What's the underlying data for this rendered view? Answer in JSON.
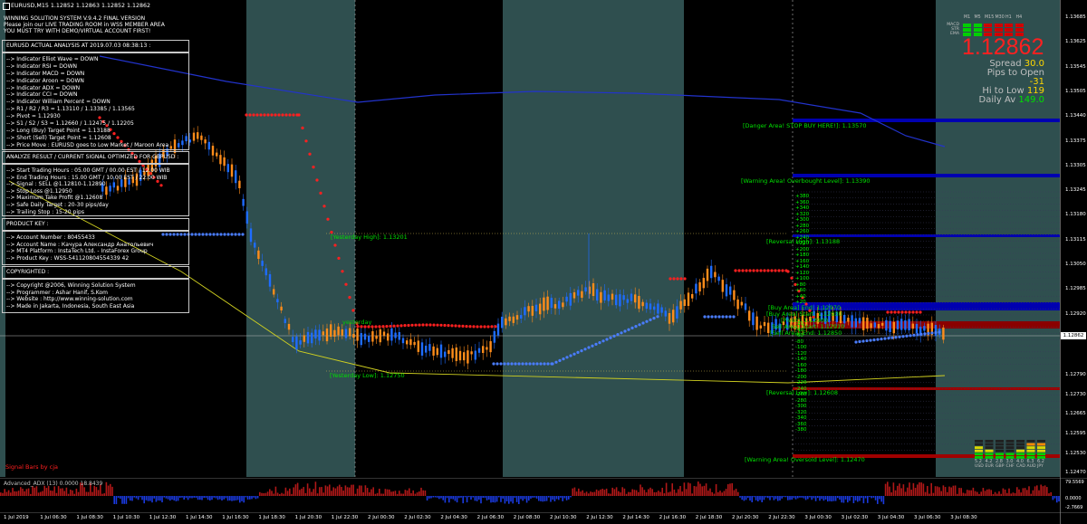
{
  "header": {
    "symbol_line": "EURUSD,M15  1.12852 1.12863 1.12852 1.12862",
    "lines": [
      "WINNING SOLUTION SYSTEM V.9.4.2 FINAL VERSION",
      "Please join our LIVE TRADING ROOM in WSS MEMBER AREA",
      "YOU MUST TRY WITH DEMO/VIRTUAL ACCOUNT FIRST!"
    ]
  },
  "analysis": {
    "title": "EURUSD ACTUAL ANALYSIS AT 2019.07.03 08:38:13 :",
    "items": [
      "--> Indicator Elliot Wave = DOWN",
      "--> Indicator RSI = DOWN",
      "--> Indicator MACD = DOWN",
      "--> Indicator Aroon = DOWN",
      "--> Indicator ADX = DOWN",
      "--> Indicator CCI = DOWN",
      "--> Indicator William Percent = DOWN",
      "--> R1 / R2 / R3 = 1.13110 / 1.13385 / 1.13565",
      "--> Pivot = 1.12930",
      "--> S1 / S2 / S3 = 1.12660 / 1.12475 / 1.12205",
      "--> Long (Buy) Target Point = 1.13188",
      "--> Short (Sell) Target Point = 1.12608",
      "--> Price Move : EURUSD goes to Low Market / Maroon Area"
    ]
  },
  "signal": {
    "title": "ANALYZE RESULT / CURRENT SIGNAL OPTIMIZED FOR GBPUSD :",
    "items": [
      "--> Start Trading Hours : 05.00 GMT / 00.00 EST / 12.00 WIB",
      "--> End Trading Hours : 15.00 GMT / 10.00 EST / 22.00 WIB",
      "--> Signal : SELL @1.12810-1.12890",
      "--> Stop Loss @1.12950",
      "--> Maximum Take Profit @1.12608",
      "--> Safe Daily Target : 20-30 pips/day",
      "--> Trailing Stop : 15-20 pips"
    ]
  },
  "product": {
    "title": "PRODUCT KEY :",
    "items": [
      "--> Account Number : 80455433",
      "--> Account Name : Качура Александр Анатольевич",
      "--> MT4 Platform : InstaTech Ltd. - InstaForex Group",
      "--> Product Key : WSS-541120804554339 42"
    ]
  },
  "copyright": {
    "title": "COPYRIGHTED :",
    "items": [
      "--> Copyright @2006, Winning Solution System",
      "--> Programmer : Ashar Hanif, S.Kom",
      "--> Website : http://www.winning-solution.com",
      "--> Made in Jakarta, Indonesia, South East Asia"
    ]
  },
  "chart_labels": {
    "yesterday_high": "[Yesterday High]: 1.13201",
    "yesterday_low": "[Yesterday Low]: 1.12750",
    "yesterday": "yesterday",
    "danger": "[Danger Area! STOP BUY HERE!]: 1.13570",
    "warning_ob": "[Warning Area! Overbought Level]: 1.13390",
    "reversal_high": "[Reversal High]: 1.13188",
    "buy_end": "[Buy Area] End: 1.12970",
    "buy_start": "[Buy Area] Start: 1.12930",
    "pivot": "[Pivot]: 1.12900",
    "sell_start": "Sell Area] Start: 1.12910",
    "sell_end": "[Sell Area] End: 1.12850",
    "reversal_low": "[Reversal Low]: 1.12608",
    "warning_os": "[Warning Area! Oversold Level]: 1.12470",
    "signal_bars": "Signal Bars by cja"
  },
  "ladder": {
    "plus": [
      "+380",
      "+360",
      "+340",
      "+320",
      "+300",
      "+280",
      "+260",
      "+240",
      "+220",
      "+200",
      "+180",
      "+160",
      "+140",
      "+120",
      "+100",
      "+80",
      "+60",
      "+40",
      "+20"
    ],
    "minus": [
      "-20",
      "-40",
      "-60",
      "-80",
      "-100",
      "-120",
      "-140",
      "-160",
      "-180",
      "-200",
      "-220",
      "-240",
      "-260",
      "-280",
      "-300",
      "-320",
      "-340",
      "-360",
      "-380"
    ]
  },
  "info_panel": {
    "timeframes": [
      "M1",
      "M5",
      "M15",
      "M30",
      "H1",
      "H4"
    ],
    "rows": [
      "MACD",
      "STR",
      "EMA"
    ],
    "big_price": "1.12862",
    "spread_label": "Spread",
    "spread_value": "30.0",
    "pips_label": "Pips to Open",
    "pips_value": "-31",
    "hilow_label": "Hi to Low",
    "hilow_value": "119",
    "daily_label": "Daily Av",
    "daily_value": "149.0"
  },
  "currency_strength": {
    "values": [
      "5.2",
      "4.2",
      "2.8",
      "3.0",
      "4.0",
      "6.3",
      "6.2"
    ],
    "currencies": [
      "USD",
      "EUR",
      "GBP",
      "CHF",
      "CAD",
      "AUD",
      "JPY"
    ]
  },
  "price_axis": [
    "1.13685",
    "1.13625",
    "1.13545",
    "1.13505",
    "1.13440",
    "1.13375",
    "1.13305",
    "1.13245",
    "1.13180",
    "1.13115",
    "1.13050",
    "1.12985",
    "1.12920",
    "1.12862",
    "1.12790",
    "1.12730",
    "1.12665",
    "1.12595",
    "1.12530",
    "1.12470"
  ],
  "current_price": "1.12862",
  "adx": {
    "label": "Advanced_ADX (13) 0.0000 18.8439",
    "axis": [
      "79.5569",
      "0.0000",
      "-2.7669"
    ]
  },
  "time_axis": [
    "1 Jul 2019",
    "1 Jul 06:30",
    "1 Jul 08:30",
    "1 Jul 10:30",
    "1 Jul 12:30",
    "1 Jul 14:30",
    "1 Jul 16:30",
    "1 Jul 18:30",
    "1 Jul 20:30",
    "1 Jul 22:30",
    "2 Jul 00:30",
    "2 Jul 02:30",
    "2 Jul 04:30",
    "2 Jul 06:30",
    "2 Jul 08:30",
    "2 Jul 10:30",
    "2 Jul 12:30",
    "2 Jul 14:30",
    "2 Jul 16:30",
    "2 Jul 18:30",
    "2 Jul 20:30",
    "2 Jul 22:30",
    "3 Jul 00:30",
    "3 Jul 02:30",
    "3 Jul 04:30",
    "3 Jul 06:30",
    "3 Jul 08:30"
  ],
  "colors": {
    "bg": "#000000",
    "session": "#2f4f4f",
    "bull": "#1e6cff",
    "bear": "#ff8c1a",
    "red_dots": "#ff2020",
    "blue_dots": "#4a7dff",
    "level_blue": "#0000b0",
    "level_red": "#a00000",
    "level_text": "#00e000"
  }
}
